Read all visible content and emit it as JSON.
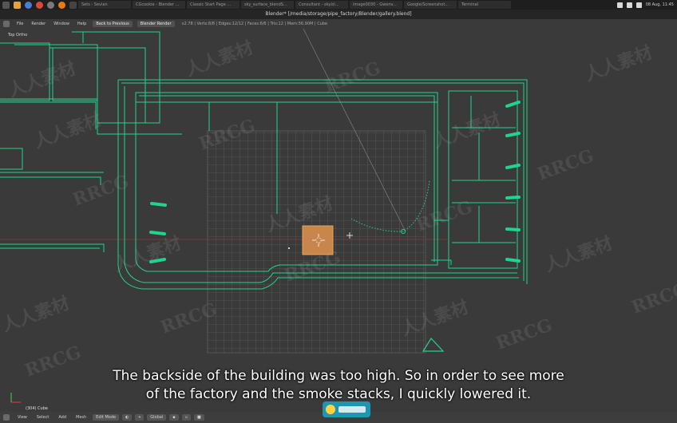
{
  "taskbar": {
    "tabs": [
      "Sets - Sevian",
      "CGcookie - Blender ...",
      "Classic Start Page ...",
      "sky_surface_blendS...",
      "Consultant - sky.bl...",
      "image0030 - Gwenv...",
      "Google/Screenshot...",
      "Terminal"
    ],
    "clock": "08 Aug, 11:45"
  },
  "window": {
    "title": "Blender* [/media/storage/pipe_factory/Blender/gallery.blend]"
  },
  "menubar": {
    "items": [
      "File",
      "Render",
      "Window",
      "Help"
    ],
    "screen_layout": "Back to Previous",
    "render_engine": "Blender Render",
    "stats": "v2.78 | Verts:8/8 | Edges:12/12 | Faces:6/6 | Tris:12 | Mem:56.90M | Cube"
  },
  "viewport": {
    "view_label": "Top Ortho",
    "object_label": "(304) Cube",
    "subtitle_line1": "The backside of the building was too high. So in order to see more",
    "subtitle_line2": "of the factory and the smoke stacks, I quickly lowered it."
  },
  "bottombar": {
    "items": [
      "View",
      "Select",
      "Add",
      "Mesh"
    ],
    "mode": "Edit Mode",
    "pivot": "Global"
  },
  "watermarks": [
    "RRCG",
    "人人素材"
  ],
  "colors": {
    "wire": "#1fd58c",
    "grid": "#5c5c5c",
    "cube": "#c8864c",
    "viewport_bg": "#3a3a3a"
  }
}
